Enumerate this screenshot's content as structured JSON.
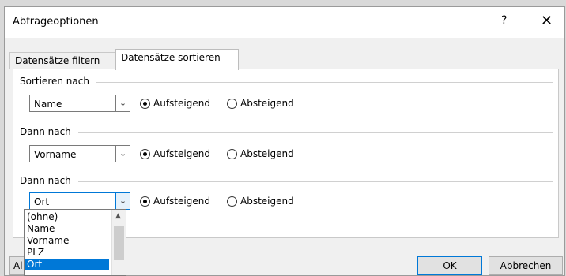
{
  "window": {
    "title": "Abfrageoptionen",
    "help_label": "?",
    "close_label": "✕"
  },
  "tabs": [
    {
      "label": "Datensätze filtern",
      "active": false
    },
    {
      "label": "Datensätze sortieren",
      "active": true
    }
  ],
  "sections": [
    {
      "label": "Sortieren nach",
      "field": "Name",
      "options": [
        {
          "label": "Aufsteigend",
          "checked": true
        },
        {
          "label": "Absteigend",
          "checked": false
        }
      ]
    },
    {
      "label": "Dann nach",
      "field": "Vorname",
      "options": [
        {
          "label": "Aufsteigend",
          "checked": true
        },
        {
          "label": "Absteigend",
          "checked": false
        }
      ]
    },
    {
      "label": "Dann nach",
      "field": "Ort",
      "options": [
        {
          "label": "Aufsteigend",
          "checked": true
        },
        {
          "label": "Absteigend",
          "checked": false
        }
      ]
    }
  ],
  "dropdown": {
    "items": [
      "(ohne)",
      "Name",
      "Vorname",
      "PLZ",
      "Ort"
    ],
    "selected": "Ort"
  },
  "buttons": {
    "left_partial": "Al",
    "ok": "OK",
    "cancel": "Abbrechen"
  },
  "icons": {
    "chevron": "chevron-down-icon",
    "scroll_up": "scroll-up-icon"
  },
  "colors": {
    "accent": "#0078d7"
  }
}
